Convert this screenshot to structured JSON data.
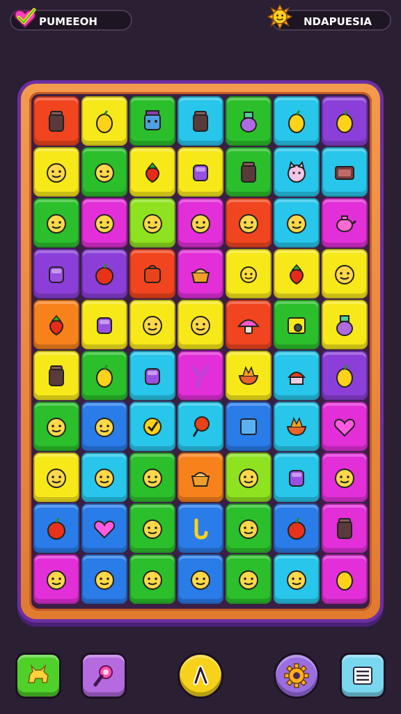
{
  "hud": {
    "left_label": "PUMEEOH",
    "right_label": "NDAPUESIA",
    "left_icon": "heart-check-icon",
    "right_icon": "sun-icon"
  },
  "board": {
    "rows": 10,
    "cols": 7,
    "tiles": [
      [
        "red",
        "yellow",
        "green",
        "cyan",
        "green",
        "cyan",
        "purple"
      ],
      [
        "yellow",
        "green",
        "yellow",
        "yellow",
        "green",
        "cyan",
        "cyan"
      ],
      [
        "green",
        "magenta",
        "lime",
        "magenta",
        "red",
        "cyan",
        "magenta"
      ],
      [
        "purple",
        "purple",
        "red",
        "magenta",
        "yellow",
        "yellow",
        "yellow"
      ],
      [
        "orange",
        "yellow",
        "yellow",
        "yellow",
        "red",
        "green",
        "yellow"
      ],
      [
        "yellow",
        "green",
        "cyan",
        "magenta",
        "yellow",
        "cyan",
        "purple"
      ],
      [
        "green",
        "blue",
        "cyan",
        "cyan",
        "blue",
        "cyan",
        "magenta"
      ],
      [
        "yellow",
        "cyan",
        "green",
        "orange",
        "lime",
        "cyan",
        "magenta"
      ],
      [
        "blue",
        "blue",
        "green",
        "blue",
        "green",
        "blue",
        "magenta"
      ],
      [
        "magenta",
        "blue",
        "green",
        "blue",
        "green",
        "cyan",
        "magenta"
      ]
    ],
    "icons": [
      [
        "jar",
        "lemon",
        "robot-face",
        "jar",
        "potion",
        "lemon",
        "lemon"
      ],
      [
        "face",
        "face",
        "strawberry",
        "cup",
        "jar",
        "cat-face",
        "box"
      ],
      [
        "face",
        "face",
        "face",
        "face",
        "face",
        "face",
        "teapot"
      ],
      [
        "cup",
        "apple",
        "bag",
        "pot",
        "sun-face",
        "strawberry",
        "face"
      ],
      [
        "strawberry",
        "cup",
        "face",
        "face",
        "mushroom",
        "camera",
        "potion"
      ],
      [
        "jar",
        "lemon",
        "cup",
        "letter-y",
        "bowl",
        "cupcake",
        "lemon"
      ],
      [
        "face",
        "face",
        "badge",
        "pin",
        "square",
        "bowl",
        "heart"
      ],
      [
        "face",
        "face",
        "face",
        "pot",
        "face",
        "cup",
        "face"
      ],
      [
        "apple",
        "heart",
        "face",
        "hook",
        "face",
        "apple",
        "jar"
      ],
      [
        "face",
        "face",
        "face",
        "face",
        "face",
        "face",
        "egg"
      ]
    ],
    "colors": {
      "red": "#f0451e",
      "yellow": "#f7e81a",
      "green": "#2bbf2b",
      "cyan": "#27c6ea",
      "purple": "#8b3fd8",
      "magenta": "#e22fd8",
      "lime": "#8ee21f",
      "orange": "#f7821c",
      "blue": "#2a7ce8"
    }
  },
  "toolbar": {
    "buttons": [
      {
        "name": "pet-button",
        "icon": "dog-icon",
        "color": "#4fd12a"
      },
      {
        "name": "magnet-button",
        "icon": "magnifier-icon",
        "color": "#b56ae0"
      },
      {
        "name": "play-button",
        "icon": "arrow-icon",
        "color": "#f7d21a"
      },
      {
        "name": "settings-button",
        "icon": "gear-icon",
        "color": "#9a6ee0"
      },
      {
        "name": "menu-button",
        "icon": "list-icon",
        "color": "#79d8ef"
      }
    ]
  }
}
